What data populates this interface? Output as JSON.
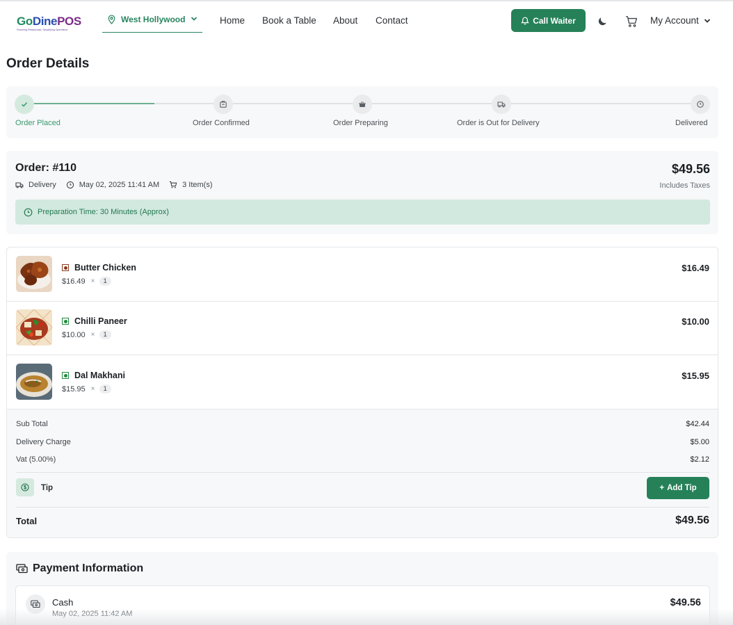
{
  "header": {
    "logo": {
      "go": "Go",
      "dine": "Dine",
      "pos": "POS",
      "tagline": "Powering Restaurants, Simplifying Operations"
    },
    "location": "West Hollywood",
    "nav": [
      "Home",
      "Book a Table",
      "About",
      "Contact"
    ],
    "call_waiter": "Call Waiter",
    "account": "My Account"
  },
  "page_title": "Order Details",
  "stepper": {
    "steps": [
      {
        "label": "Order Placed",
        "done": true,
        "icon": "check-icon"
      },
      {
        "label": "Order Confirmed",
        "done": false,
        "icon": "clipboard-icon"
      },
      {
        "label": "Order Preparing",
        "done": false,
        "icon": "cooking-pot-icon"
      },
      {
        "label": "Order is Out for Delivery",
        "done": false,
        "icon": "truck-icon"
      },
      {
        "label": "Delivered",
        "done": false,
        "icon": "clock-icon"
      }
    ]
  },
  "order": {
    "number": "Order: #110",
    "type": "Delivery",
    "datetime": "May 02, 2025 11:41 AM",
    "items_count": "3 Item(s)",
    "total": "$49.56",
    "includes_taxes": "Includes Taxes",
    "prep_time": "Preparation Time: 30 Minutes (Approx)"
  },
  "items": [
    {
      "name": "Butter Chicken",
      "unit_price": "$16.49",
      "qty": "1",
      "price": "$16.49",
      "veg": false
    },
    {
      "name": "Chilli Paneer",
      "unit_price": "$10.00",
      "qty": "1",
      "price": "$10.00",
      "veg": true
    },
    {
      "name": "Dal Makhani",
      "unit_price": "$15.95",
      "qty": "1",
      "price": "$15.95",
      "veg": true
    }
  ],
  "totals": {
    "sub_total_label": "Sub Total",
    "sub_total": "$42.44",
    "delivery_label": "Delivery Charge",
    "delivery": "$5.00",
    "vat_label": "Vat (5.00%)",
    "vat": "$2.12",
    "tip_label": "Tip",
    "add_tip": "Add Tip",
    "total_label": "Total",
    "total": "$49.56"
  },
  "payment": {
    "title": "Payment Information",
    "method": "Cash",
    "date": "May 02, 2025 11:42 AM",
    "amount": "$49.56"
  },
  "colors": {
    "brand_green": "#268158",
    "veg_green": "#1e8a3e",
    "nonveg_brown": "#8b3a1e"
  }
}
